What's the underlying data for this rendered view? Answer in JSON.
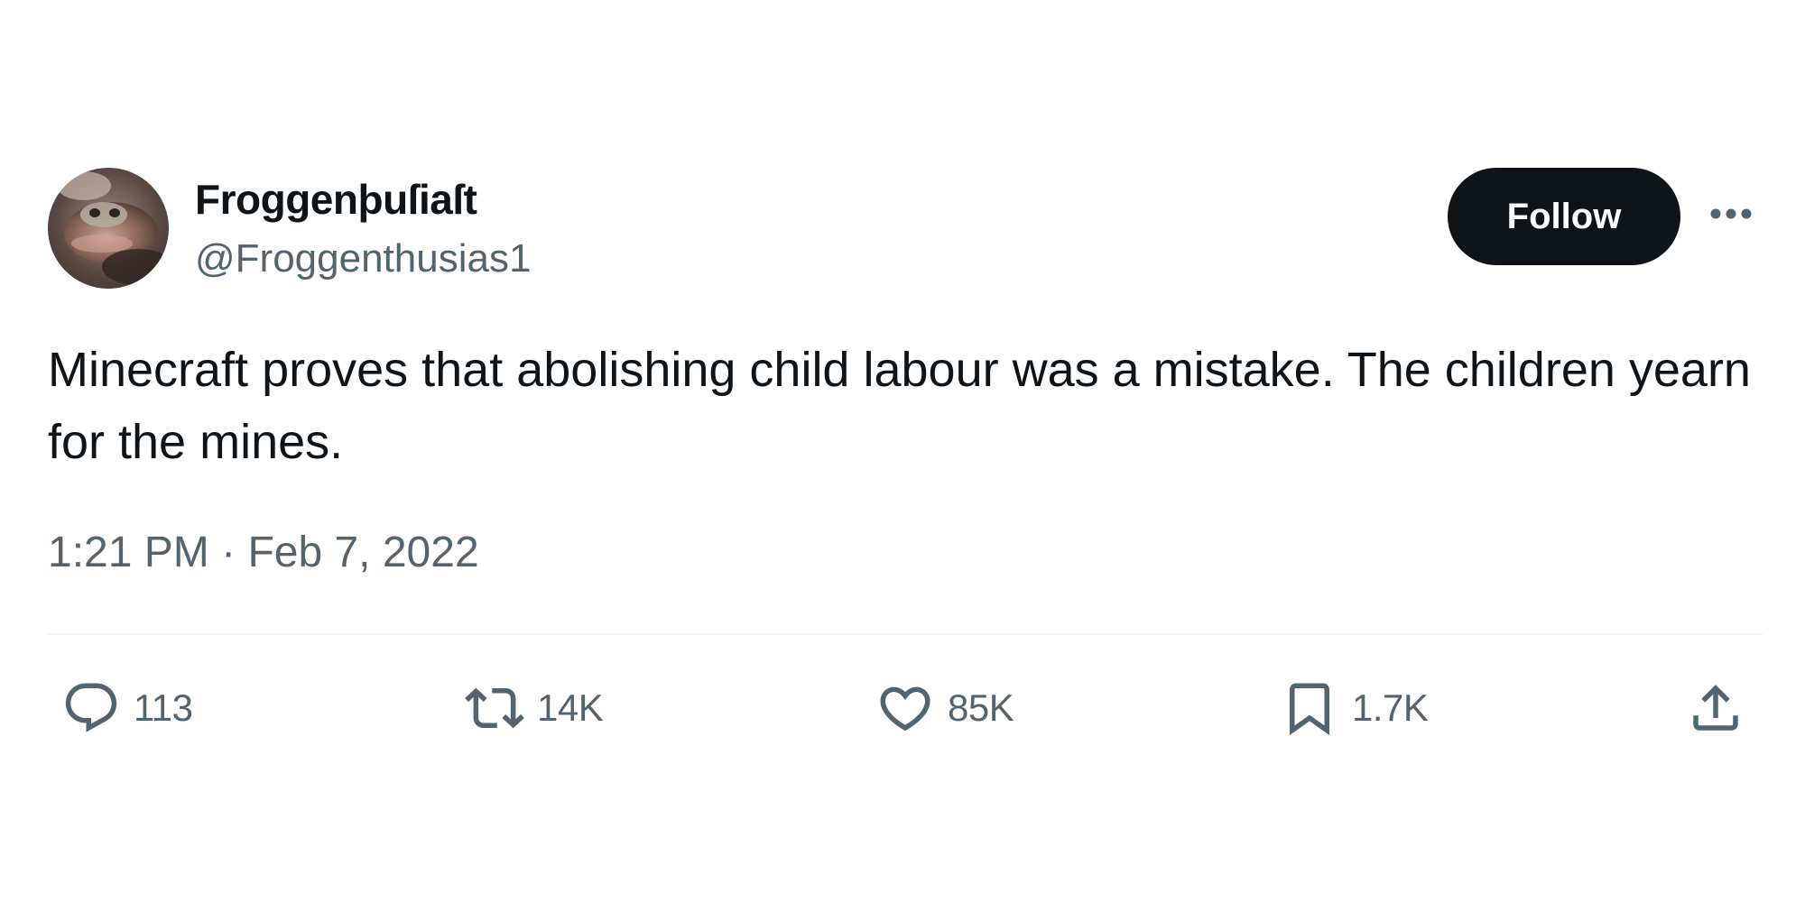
{
  "author": {
    "display_name": "Froggenþuſiaſt",
    "handle": "@Froggenthusias1",
    "avatar": "frog-photo"
  },
  "follow_label": "Follow",
  "more_icon": "more-horizontal-icon",
  "tweet": {
    "text": "Minecraft proves that abolishing child labour was a mistake. The children yearn for the mines.",
    "time": "1:21 PM",
    "separator": "·",
    "date": "Feb 7, 2022"
  },
  "actions": {
    "replies": {
      "icon": "reply-icon",
      "count": "113"
    },
    "reposts": {
      "icon": "repost-icon",
      "count": "14K"
    },
    "likes": {
      "icon": "heart-icon",
      "count": "85K"
    },
    "bookmarks": {
      "icon": "bookmark-icon",
      "count": "1.7K"
    },
    "share": {
      "icon": "share-icon"
    }
  },
  "colors": {
    "text_primary": "#0f1419",
    "text_secondary": "#536471",
    "divider": "#eff3f4",
    "follow_bg": "#0f1419",
    "follow_text": "#ffffff"
  }
}
